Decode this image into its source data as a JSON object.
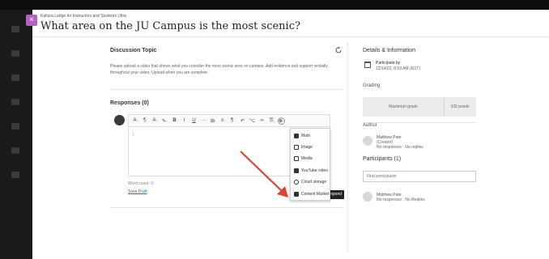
{
  "header": {
    "close_label": "×",
    "course_name": "Kaltura Lodge for Instructors and Students Ultra",
    "title": "What area on the JU Campus is the most scenic?"
  },
  "topic": {
    "heading": "Discussion Topic",
    "body": "Please upload a video that shows what you consider the most scenic area on campus. Add evidence and support verbally throughout your video. Upload when you are complete."
  },
  "responses": {
    "heading": "Responses (0)",
    "word_count": "Word count: 0",
    "save_draft": "Save Draft",
    "post_label": "Respond"
  },
  "toolbar": {
    "buttons": [
      "A·",
      "¶·",
      "A·",
      "✎·",
      "B",
      "I",
      "U",
      "···",
      "⊞·",
      "≡·",
      "¶·",
      "↶",
      "⌥",
      "∞",
      "⎘",
      "⊕·"
    ]
  },
  "insert_menu": {
    "items": [
      {
        "label": "Math",
        "icon": "math-icon"
      },
      {
        "label": "Image",
        "icon": "image-icon"
      },
      {
        "label": "Media",
        "icon": "media-icon"
      },
      {
        "label": "YouTube video",
        "icon": "youtube-icon"
      },
      {
        "label": "Cloud storage",
        "icon": "cloud-icon"
      },
      {
        "label": "Content Market",
        "icon": "content-market-icon"
      }
    ]
  },
  "details": {
    "heading": "Details & Information",
    "participate_label": "Participate by",
    "participate_date": "12/14/22, 8:59 AM (EST)",
    "grading_label": "Grading",
    "max_grade_label": "Maximum grade",
    "max_grade_value": "100 points",
    "author_label": "Author",
    "author_name": "Matthew Pate",
    "author_role": "(Creator)",
    "author_stats": "No responses · No replies",
    "participants_heading": "Participants (1)",
    "search_placeholder": "Find participants",
    "participant_name": "Matthew Pate",
    "participant_stats": "No responses · No Replies"
  },
  "colors": {
    "accent": "#b65fc6",
    "arrow": "#e0403a",
    "link": "#2a6db5"
  }
}
